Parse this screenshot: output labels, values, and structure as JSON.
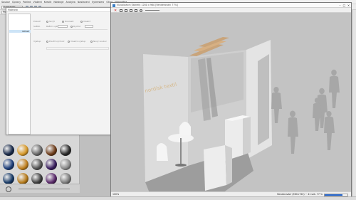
{
  "menubar": {
    "items": [
      "Soubor",
      "Úpravy",
      "Pohled",
      "Vložení",
      "Kreslit",
      "Nástroje",
      "Analýza",
      "Nastavení",
      "Vykreslení",
      "Okno",
      "Nápověda"
    ]
  },
  "toolbar": {
    "combo_value": "Standardní"
  },
  "subbar": {
    "tab_label": "Proj"
  },
  "dialog": {
    "title": "Možnosti",
    "list_selected": "Vzhled",
    "options": [
      {
        "label": "Skrýt",
        "label2": "Zobrazit",
        "label3": "Vlastní"
      },
      {
        "label": "Režim vykr.",
        "label2": "Rychlé"
      },
      {
        "label": "Použít výchozí",
        "label2": "Vlastní výstup",
        "label3": "Nový soubor"
      }
    ],
    "row_labels": [
      "Pozadí",
      "Světlo",
      "Výstup"
    ]
  },
  "render_window": {
    "title": "Vizualizace (Stánek) 1280 x 960  [Renderování 77%]",
    "status_left": "100%",
    "status_right": "Renderování (960×720)   ~ 41 sek.   77 %",
    "progress": 0.77
  },
  "booth_sign": "nordisk textil"
}
